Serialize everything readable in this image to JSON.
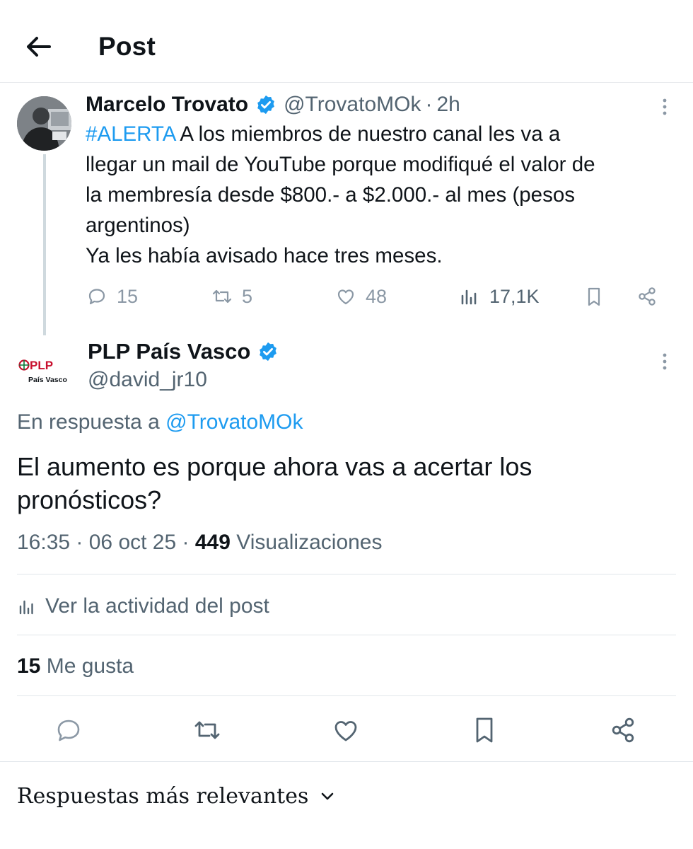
{
  "header": {
    "back_icon": "arrow-left-icon",
    "title": "Post"
  },
  "parent_post": {
    "author_name": "Marcelo Trovato",
    "verified": true,
    "handle": "@TrovatoMOk",
    "separator": "·",
    "time": "2h",
    "hashtag": "#ALERTA",
    "text_lines": [
      " A los miembros de nuestro canal les va a",
      "llegar un mail de YouTube porque modifiqué el valor de",
      "la membresía desde $800.- a $2.000.- al mes (pesos",
      "argentinos)",
      "Ya les había avisado hace tres meses."
    ],
    "replies": "15",
    "reposts": "5",
    "likes": "48",
    "views": "17,1K"
  },
  "main_post": {
    "author_name": "PLP País Vasco",
    "verified": true,
    "handle": "@david_jr10",
    "avatar_text_top": "PLP",
    "avatar_text_bottom": "País Vasco",
    "reply_prefix": "En respuesta a ",
    "reply_mention": "@TrovatoMOk",
    "text": "El aumento es porque ahora vas a acertar los pronósticos?",
    "time": "16:35",
    "dot1": " · ",
    "date": "06 oct 25",
    "dot2": " · ",
    "views_count": "449",
    "views_label": " Visualizaciones",
    "activity_label": "Ver la actividad del post",
    "likes_count": "15",
    "likes_label": " Me gusta"
  },
  "sort": {
    "label": "Respuestas más relevantes"
  },
  "colors": {
    "accent": "#1d9bf0",
    "text_primary": "#0f1419",
    "text_secondary": "#536471",
    "icon_muted": "#8b98a5",
    "divider": "#e1e6ea"
  }
}
